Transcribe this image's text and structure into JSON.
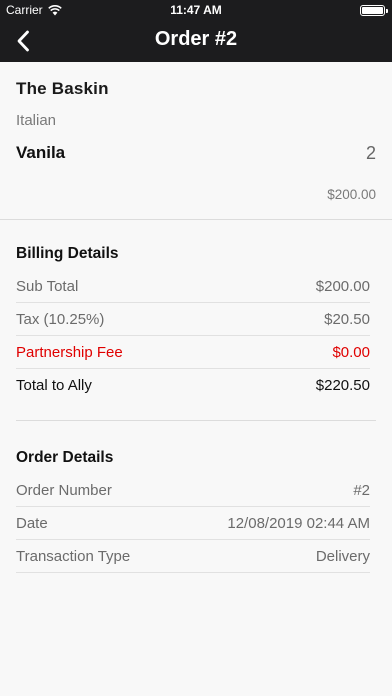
{
  "status_bar": {
    "carrier": "Carrier",
    "time": "11:47 AM"
  },
  "nav": {
    "title": "Order #2",
    "back_icon": "chevron-left-icon"
  },
  "order_item": {
    "restaurant": "The Baskin",
    "cuisine": "Italian",
    "item_name": "Vanila",
    "quantity": "2",
    "price": "$200.00"
  },
  "billing": {
    "title": "Billing Details",
    "rows": [
      {
        "label": "Sub Total",
        "value": "$200.00"
      },
      {
        "label": "Tax (10.25%)",
        "value": "$20.50"
      },
      {
        "label": "Partnership Fee",
        "value": "$0.00"
      },
      {
        "label": "Total to Ally",
        "value": "$220.50"
      }
    ]
  },
  "order_details": {
    "title": "Order Details",
    "rows": [
      {
        "label": "Order Number",
        "value": "#2"
      },
      {
        "label": "Date",
        "value": "12/08/2019 02:44 AM"
      },
      {
        "label": "Transaction Type",
        "value": "Delivery"
      }
    ]
  },
  "colors": {
    "nav_background": "#1c1c1e",
    "accent_red": "#e00000",
    "background": "#f8f8f8"
  }
}
